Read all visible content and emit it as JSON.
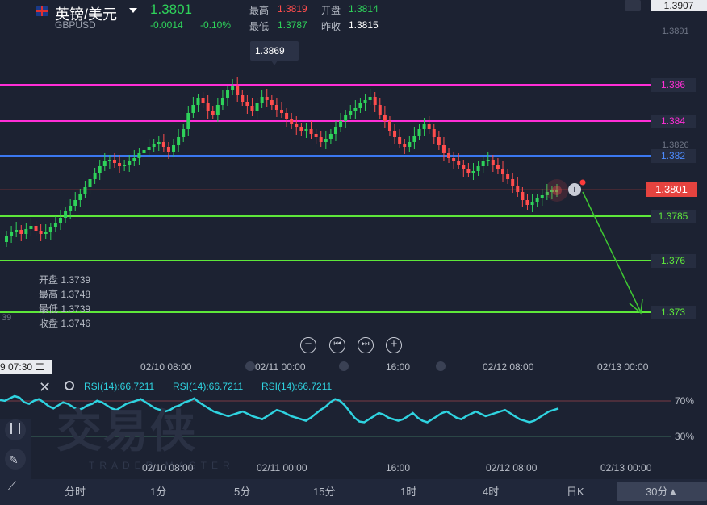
{
  "header": {
    "title": "英镑/美元",
    "symbol": "GBPUSD",
    "price": "1.3801",
    "change": "-0.0014",
    "change_pct": "-0.10%",
    "high_label": "最高",
    "high_value": "1.3819",
    "open_label": "开盘",
    "open_value": "1.3814",
    "low_label": "最低",
    "low_value": "1.3787",
    "prev_close_label": "昨收",
    "prev_close_value": "1.3815"
  },
  "axis": {
    "top_price": "1.3907",
    "ticks": [
      "1.3891",
      "1.3826"
    ],
    "tick39": "39",
    "tooltip_high": "1.3869",
    "current_tag": "1.3801"
  },
  "levels": [
    {
      "label": "1.386",
      "color": "#ff2ed6"
    },
    {
      "label": "1.384",
      "color": "#ff2ed6"
    },
    {
      "label": "1.382",
      "color": "#3b78f0"
    },
    {
      "label": "1.3785",
      "color": "#5ee83a"
    },
    {
      "label": "1.376",
      "color": "#5ee83a"
    },
    {
      "label": "1.373",
      "color": "#5ee83a"
    }
  ],
  "ohlc": {
    "open": "开盘 1.3739",
    "high": "最高 1.3748",
    "low": "最低 1.3739",
    "close": "收盘 1.3746"
  },
  "xaxis": [
    "02/10 08:00",
    "02/11 00:00",
    "16:00",
    "02/12 08:00",
    "02/13 00:00"
  ],
  "crosshair_time": "9 07:30 二",
  "rsi": {
    "label1": "RSI(14):66.7211",
    "label2": "RSI(14):66.7211",
    "label3": "RSI(14):66.7211",
    "level_high": "70%",
    "level_low": "30%"
  },
  "rsi_xaxis": [
    "02/10 08:00",
    "02/11 00:00",
    "16:00",
    "02/12 08:00",
    "02/13 00:00"
  ],
  "watermark": {
    "main": "交易侠",
    "sub": "TRADER MASTER"
  },
  "tabs": [
    "分时",
    "1分",
    "5分",
    "15分",
    "1时",
    "4时",
    "日K",
    "30分▲"
  ],
  "colors": {
    "up": "#2ed25a",
    "down": "#ff4d4d",
    "rsi": "#2fd3e0"
  },
  "chart_data": {
    "type": "candlestick",
    "rsi_values": [
      73,
      72,
      75,
      78,
      76,
      70,
      68,
      72,
      74,
      70,
      65,
      62,
      66,
      70,
      68,
      64,
      60,
      62,
      66,
      68,
      72,
      70,
      66,
      62,
      60,
      64,
      68,
      70,
      72,
      74,
      70,
      66,
      62,
      60,
      58,
      60,
      64,
      66,
      70,
      72,
      75,
      70,
      66,
      62,
      58,
      56,
      54,
      52,
      54,
      56,
      58,
      55,
      52,
      50,
      48,
      52,
      56,
      60,
      58,
      55,
      52,
      50,
      48,
      46,
      50,
      55,
      60,
      64,
      70,
      74,
      72,
      66,
      58,
      50,
      45,
      44,
      48,
      52,
      56,
      54,
      50,
      48,
      46,
      48,
      52,
      56,
      50,
      46,
      44,
      48,
      52,
      56,
      58,
      54,
      50,
      48,
      52,
      55,
      58,
      55,
      52,
      54,
      56,
      58,
      60,
      56,
      52,
      48,
      46,
      44,
      46,
      50,
      54,
      58,
      60,
      62
    ],
    "rsi_levels": [
      70,
      30
    ]
  }
}
